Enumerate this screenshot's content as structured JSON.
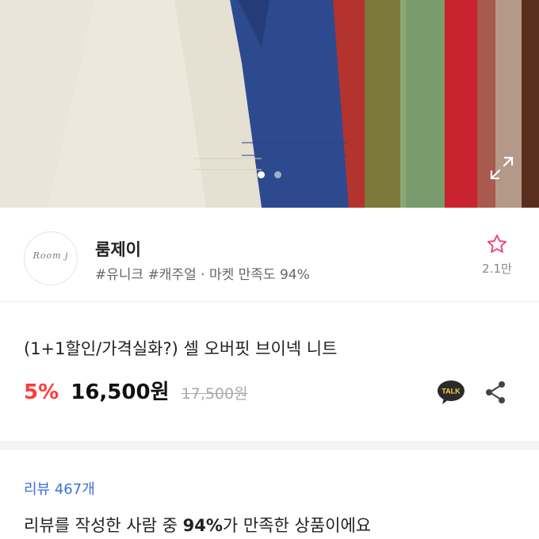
{
  "colors": {
    "accent_red": "#ff3b3b",
    "star_pink": "#f0487a",
    "link_blue": "#3a6fd9",
    "kakao_yellow": "#2b2b2b"
  },
  "gallery": {
    "image_label": "sweaters",
    "slide_count": 2,
    "active_slide": 1,
    "expand_icon": "expand-icon"
  },
  "shop": {
    "logo_text": "Room j",
    "name": "룸제이",
    "tags": "#유니크 #캐주얼 · 마켓 만족도 94%",
    "favorite_icon": "star-icon",
    "favorite_count": "2.1만"
  },
  "product": {
    "title": "(1+1할인/가격실화?) 셀 오버핏 브이넥 니트",
    "discount": "5%",
    "price": "16,500원",
    "original_price": "17,500원",
    "talk_label": "TALK",
    "share_icon": "share-icon"
  },
  "reviews": {
    "link_label": "리뷰 467개",
    "summary_before": "리뷰를 작성한 사람 중 ",
    "summary_highlight": "94%",
    "summary_after": "가 만족한 상품이에요"
  }
}
